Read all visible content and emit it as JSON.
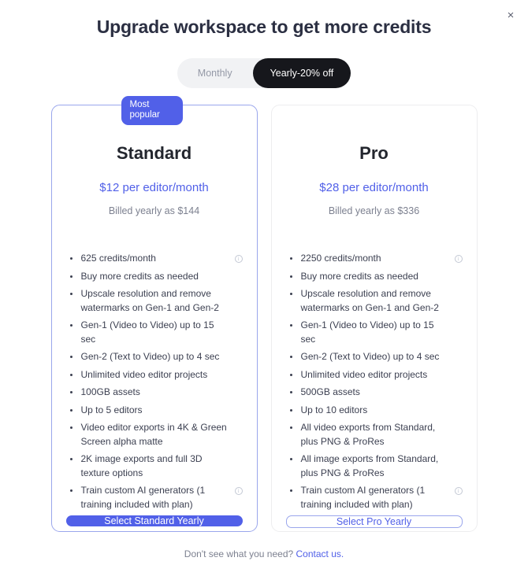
{
  "modal": {
    "title": "Upgrade workspace to get more credits",
    "close_icon": "close-icon",
    "close_label": "×"
  },
  "billing_toggle": {
    "options": [
      {
        "label": "Monthly",
        "active": false
      },
      {
        "label": "Yearly-20% off",
        "active": true
      }
    ]
  },
  "plans": [
    {
      "badge": "Most popular",
      "name": "Standard",
      "price": "$12 per editor/month",
      "billed": "Billed yearly as $144",
      "cta": "Select Standard Yearly",
      "features": [
        {
          "text": "625 credits/month",
          "info": true
        },
        {
          "text": "Buy more credits as needed",
          "info": false
        },
        {
          "text": "Upscale resolution and remove watermarks on Gen-1 and Gen-2",
          "info": false
        },
        {
          "text": "Gen-1 (Video to Video) up to 15 sec",
          "info": false
        },
        {
          "text": "Gen-2 (Text to Video) up to 4 sec",
          "info": false
        },
        {
          "text": "Unlimited video editor projects",
          "info": false
        },
        {
          "text": "100GB assets",
          "info": false
        },
        {
          "text": "Up to 5 editors",
          "info": false
        },
        {
          "text": "Video editor exports in 4K & Green Screen alpha matte",
          "info": false
        },
        {
          "text": "2K image exports and full 3D texture options",
          "info": false
        },
        {
          "text": "Train custom AI generators (1 training included with plan)",
          "info": true
        }
      ]
    },
    {
      "badge": null,
      "name": "Pro",
      "price": "$28 per editor/month",
      "billed": "Billed yearly as $336",
      "cta": "Select Pro Yearly",
      "features": [
        {
          "text": "2250 credits/month",
          "info": true
        },
        {
          "text": "Buy more credits as needed",
          "info": false
        },
        {
          "text": "Upscale resolution and remove watermarks on Gen-1 and Gen-2",
          "info": false
        },
        {
          "text": "Gen-1 (Video to Video) up to 15 sec",
          "info": false
        },
        {
          "text": "Gen-2 (Text to Video) up to 4 sec",
          "info": false
        },
        {
          "text": "Unlimited video editor projects",
          "info": false
        },
        {
          "text": "500GB assets",
          "info": false
        },
        {
          "text": "Up to 10 editors",
          "info": false
        },
        {
          "text": "All video exports from Standard, plus PNG & ProRes",
          "info": false
        },
        {
          "text": "All image exports from Standard, plus PNG & ProRes",
          "info": false
        },
        {
          "text": "Train custom AI generators (1 training included with plan)",
          "info": true
        }
      ]
    }
  ],
  "footer": {
    "text": "Don't see what you need?",
    "link": "Contact us."
  },
  "colors": {
    "accent": "#5160e8",
    "toggle_active_bg": "#16171c",
    "title": "#2b2f42",
    "muted": "#7d8190"
  },
  "info_icon_glyph": "i"
}
